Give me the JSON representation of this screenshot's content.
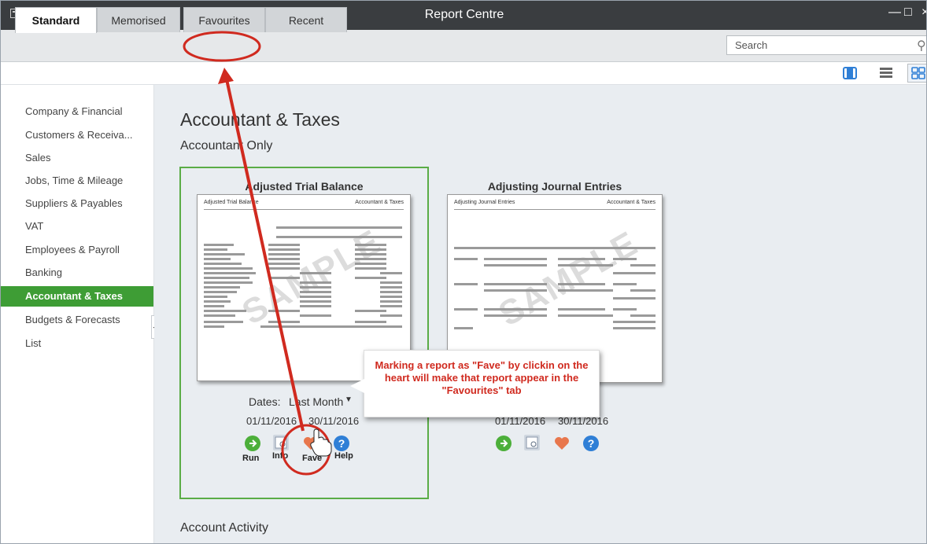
{
  "window": {
    "title": "Report Centre"
  },
  "tabs": [
    {
      "label": "Standard",
      "active": true
    },
    {
      "label": "Memorised",
      "active": false
    },
    {
      "label": "Favourites",
      "active": false
    },
    {
      "label": "Recent",
      "active": false
    }
  ],
  "search": {
    "placeholder": "Search"
  },
  "sidebar": {
    "items": [
      {
        "label": "Company & Financial",
        "active": false
      },
      {
        "label": "Customers & Receiva...",
        "active": false
      },
      {
        "label": "Sales",
        "active": false
      },
      {
        "label": "Jobs, Time & Mileage",
        "active": false
      },
      {
        "label": "Suppliers & Payables",
        "active": false
      },
      {
        "label": "VAT",
        "active": false
      },
      {
        "label": "Employees & Payroll",
        "active": false
      },
      {
        "label": "Banking",
        "active": false
      },
      {
        "label": "Accountant & Taxes",
        "active": true
      },
      {
        "label": "Budgets & Forecasts",
        "active": false
      },
      {
        "label": "List",
        "active": false
      }
    ]
  },
  "main": {
    "heading": "Accountant & Taxes",
    "subheading": "Accountant Only",
    "next_section": "Account Activity",
    "cards": [
      {
        "title": "Adjusted Trial Balance",
        "thumb_header_left": "Adjusted Trial Balance",
        "thumb_header_right": "Accountant & Taxes",
        "watermark": "SAMPLE",
        "dates_label": "Dates:",
        "dates_value": "Last Month",
        "from": "01/11/2016",
        "to": "30/11/2016",
        "actions": [
          "Run",
          "Info",
          "Fave",
          "Help"
        ]
      },
      {
        "title": "Adjusting Journal Entries",
        "thumb_header_left": "Adjusting Journal Entries",
        "thumb_header_right": "Accountant & Taxes",
        "watermark": "SAMPLE",
        "from": "01/11/2016",
        "to": "30/11/2016"
      }
    ]
  },
  "annotation": {
    "callout": "Marking a report as \"Fave\" by clickin on the heart will make that report appear in the \"Favourites\" tab"
  },
  "colors": {
    "accent_green": "#3e9d35",
    "annotation_red": "#d02a1f",
    "titlebar": "#3a3d40"
  }
}
